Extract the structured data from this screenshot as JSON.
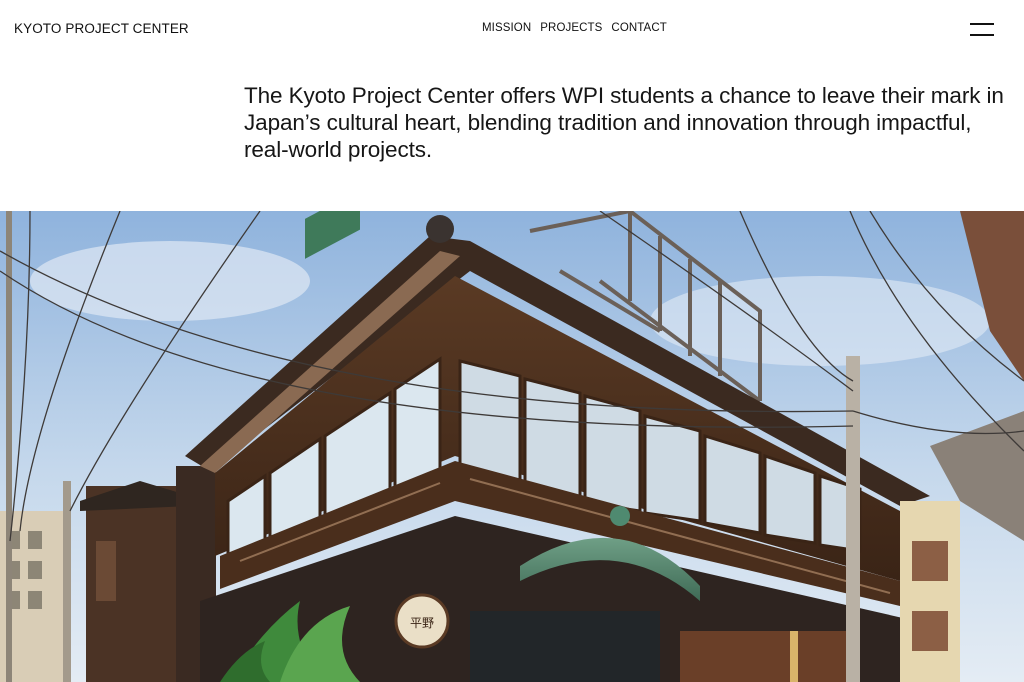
{
  "header": {
    "brand": "KYOTO PROJECT CENTER",
    "nav": [
      {
        "label": "MISSION"
      },
      {
        "label": "PROJECTS"
      },
      {
        "label": "CONTACT"
      }
    ],
    "menu_icon": "hamburger-menu-icon"
  },
  "intro": {
    "text": "The Kyoto Project Center offers WPI students a chance to leave their mark in Japan’s cultural heart, blending tradition and innovation through impactful, real-world projects."
  },
  "hero": {
    "sign_text": "平野"
  }
}
